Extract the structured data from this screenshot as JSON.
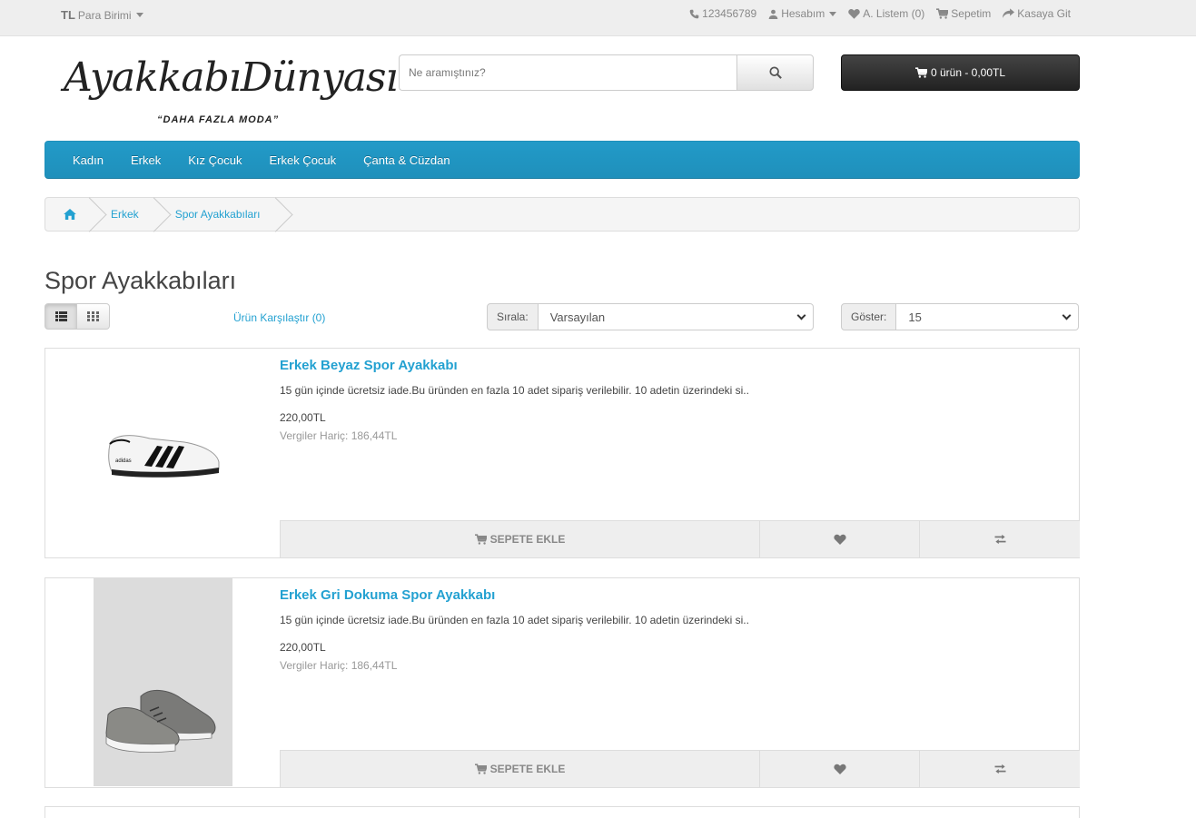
{
  "topbar": {
    "currency_symbol": "TL",
    "currency_label": "Para Birimi",
    "phone": "123456789",
    "account": "Hesabım",
    "wishlist": "A. Listem (0)",
    "cart": "Sepetim",
    "checkout": "Kasaya Git"
  },
  "logo": {
    "title": "AyakkabıDünyası",
    "subtitle": "“DAHA FAZLA MODA”"
  },
  "search": {
    "placeholder": "Ne aramıştınız?"
  },
  "cart_button": "0 ürün - 0,00TL",
  "menu": [
    "Kadın",
    "Erkek",
    "Kız Çocuk",
    "Erkek Çocuk",
    "Çanta & Cüzdan"
  ],
  "breadcrumb": [
    "Erkek",
    "Spor Ayakkabıları"
  ],
  "page_title": "Spor Ayakkabıları",
  "compare_link": "Ürün Karşılaştır (0)",
  "sort": {
    "label": "Sırala:",
    "value": "Varsayılan"
  },
  "limit": {
    "label": "Göster:",
    "value": "15"
  },
  "products": [
    {
      "name": "Erkek Beyaz Spor Ayakkabı",
      "description": "15 gün içinde ücretsiz iade.Bu üründen en fazla 10 adet sipariş verilebilir. 10 adetin üzerindeki si..",
      "price": "220,00TL",
      "tax": "Vergiler Hariç: 186,44TL",
      "add_label": "SEPETE EKLE"
    },
    {
      "name": "Erkek Gri Dokuma Spor Ayakkabı",
      "description": "15 gün içinde ücretsiz iade.Bu üründen en fazla 10 adet sipariş verilebilir. 10 adetin üzerindeki si..",
      "price": "220,00TL",
      "tax": "Vergiler Hariç: 186,44TL",
      "add_label": "SEPETE EKLE"
    }
  ]
}
